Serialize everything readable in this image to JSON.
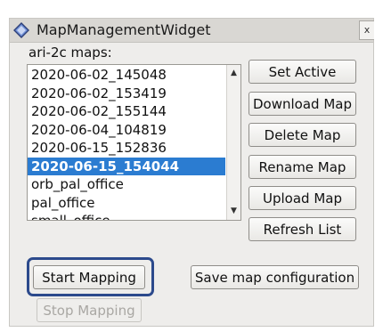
{
  "window": {
    "title": "MapManagementWidget",
    "close_label": "x",
    "accent_color": "#2c4a8c",
    "selection_color": "#2b7cd1"
  },
  "maps": {
    "label": "ari-2c maps:",
    "items": [
      "2020-06-02_145048",
      "2020-06-02_153419",
      "2020-06-02_155144",
      "2020-06-04_104819",
      "2020-06-15_152836",
      "2020-06-15_154044",
      "orb_pal_office",
      "pal_office",
      "small_office"
    ],
    "selected": "2020-06-15_154044"
  },
  "buttons": {
    "set_active": "Set Active",
    "download_map": "Download Map",
    "delete_map": "Delete Map",
    "rename_map": "Rename Map",
    "upload_map": "Upload Map",
    "refresh_list": "Refresh List",
    "start_mapping": "Start Mapping",
    "stop_mapping": "Stop Mapping",
    "save_map_configuration": "Save map configuration"
  }
}
